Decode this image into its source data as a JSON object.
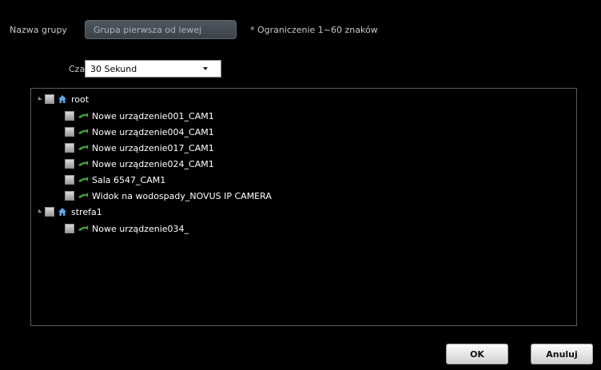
{
  "group": {
    "name_label": "Nazwa grupy",
    "name_value": "Grupa pierwsza od lewej",
    "hint": "* Ograniczenie 1~60 znaków"
  },
  "time": {
    "label": "Czas",
    "selected": "30 Sekund"
  },
  "tree": {
    "root": {
      "label": "root",
      "children": [
        "Nowe urządzenie001_CAM1",
        "Nowe urządzenie004_CAM1",
        "Nowe urządzenie017_CAM1",
        "Nowe urządzenie024_CAM1",
        "Sala 6547_CAM1",
        "Widok na wodospady_NOVUS IP CAMERA"
      ]
    },
    "strefa1": {
      "label": "strefa1",
      "children": [
        "Nowe urządzenie034_"
      ]
    }
  },
  "buttons": {
    "ok": "OK",
    "cancel": "Anuluj"
  },
  "colors": {
    "background": "#000000",
    "camera_icon": "#3fae3a",
    "home_icon": "#5aa9e6"
  },
  "icons": {
    "group_node": "home-icon",
    "device_node": "camera-icon",
    "expander": "expander-triangle"
  }
}
